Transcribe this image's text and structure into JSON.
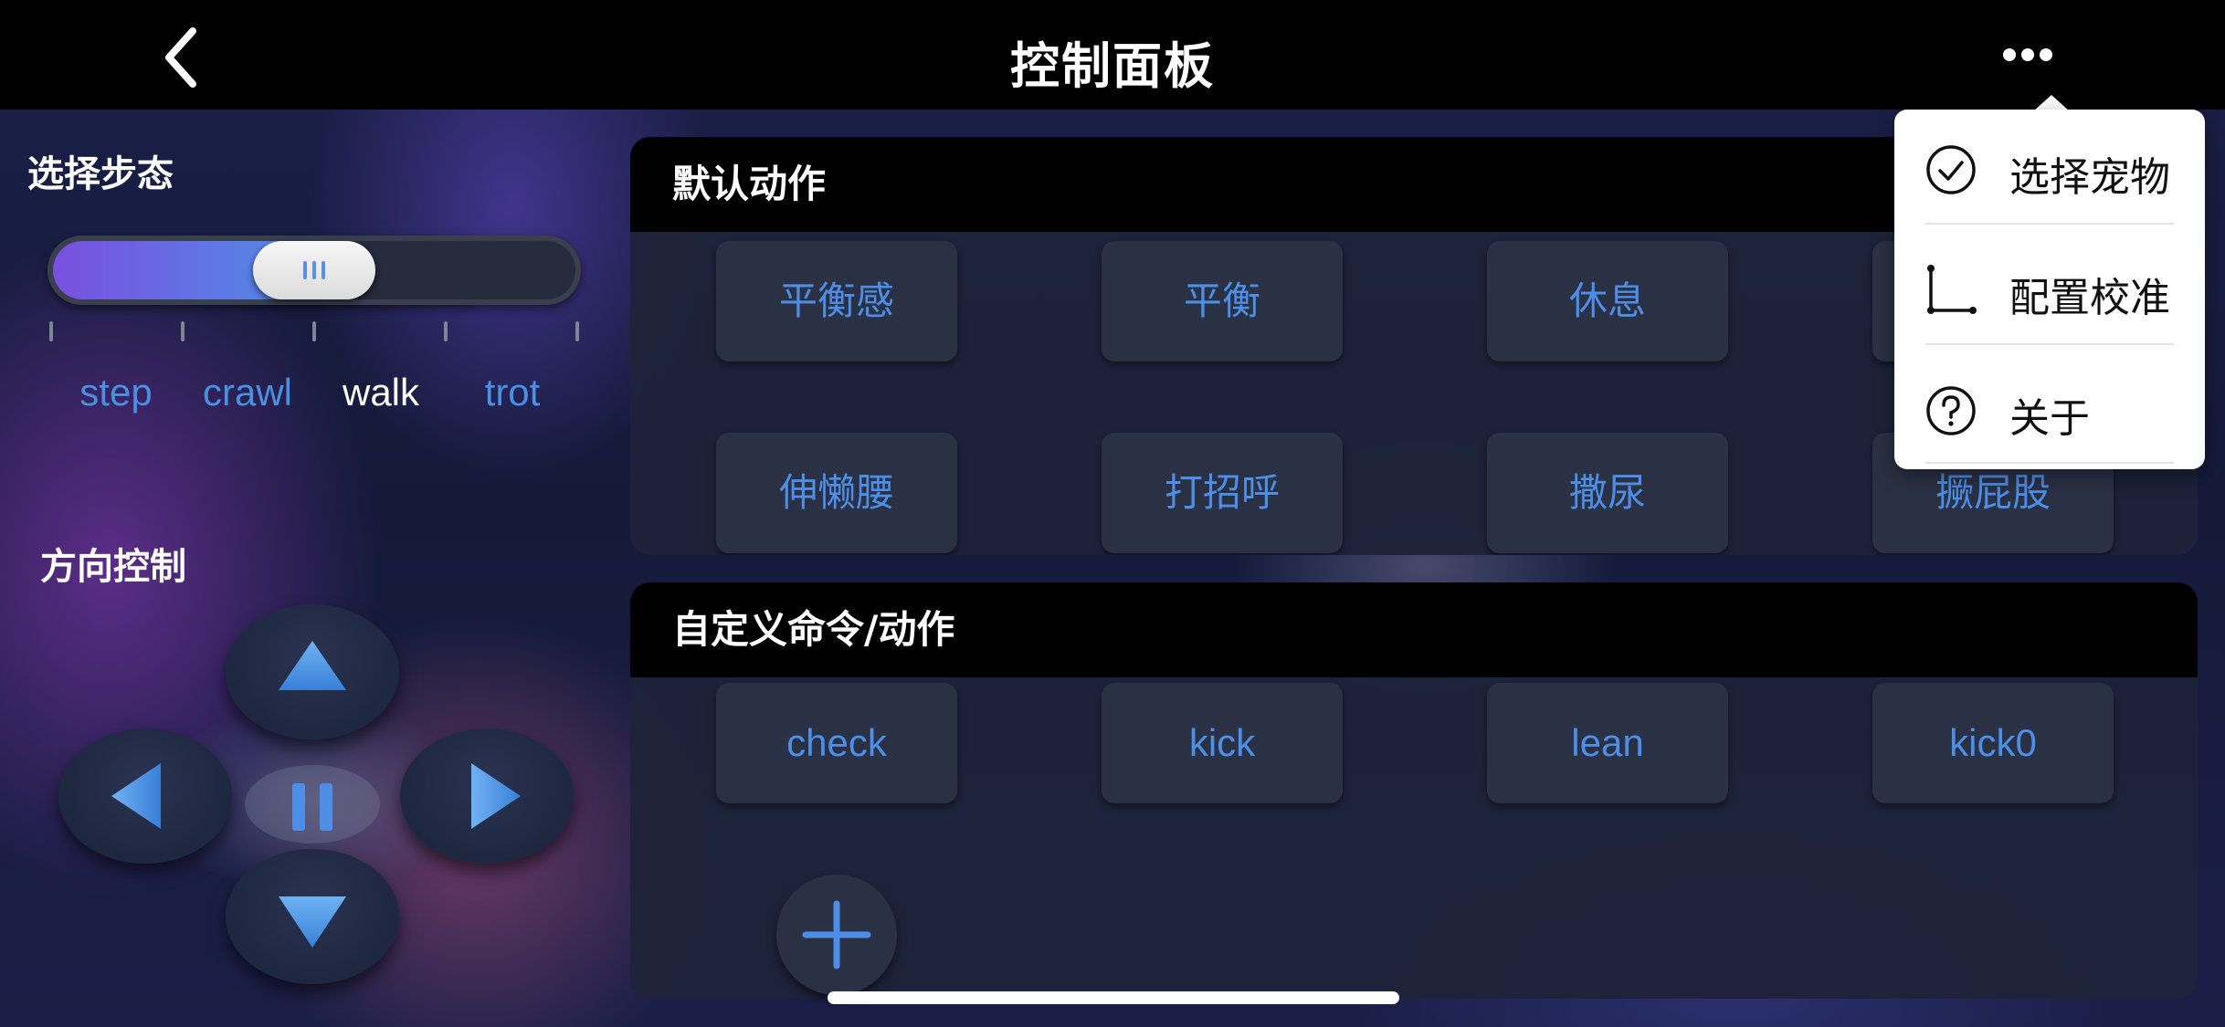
{
  "header": {
    "title": "控制面板"
  },
  "gait": {
    "label": "选择步态",
    "options": [
      "step",
      "crawl",
      "walk",
      "trot"
    ],
    "selected": "walk",
    "level": 0.5,
    "fill_color": "#7a4fe0",
    "accent_color": "#4d8ee6"
  },
  "direction": {
    "label": "方向控制"
  },
  "default_actions": {
    "title": "默认动作",
    "buttons": [
      "平衡感",
      "平衡",
      "休息",
      "",
      "伸懒腰",
      "打招呼",
      "撒尿",
      "撅屁股"
    ]
  },
  "custom_actions": {
    "title": "自定义命令/动作",
    "buttons": [
      "check",
      "kick",
      "lean",
      "kick0"
    ]
  },
  "menu": {
    "items": [
      {
        "label": "选择宠物",
        "icon": "check-circle-icon"
      },
      {
        "label": "配置校准",
        "icon": "calibration-icon"
      },
      {
        "label": "关于",
        "icon": "question-circle-icon"
      }
    ]
  },
  "icons": {
    "back": "chevron-left-icon",
    "more": "more-dots-icon",
    "add": "plus-icon",
    "pause": "pause-icon"
  }
}
